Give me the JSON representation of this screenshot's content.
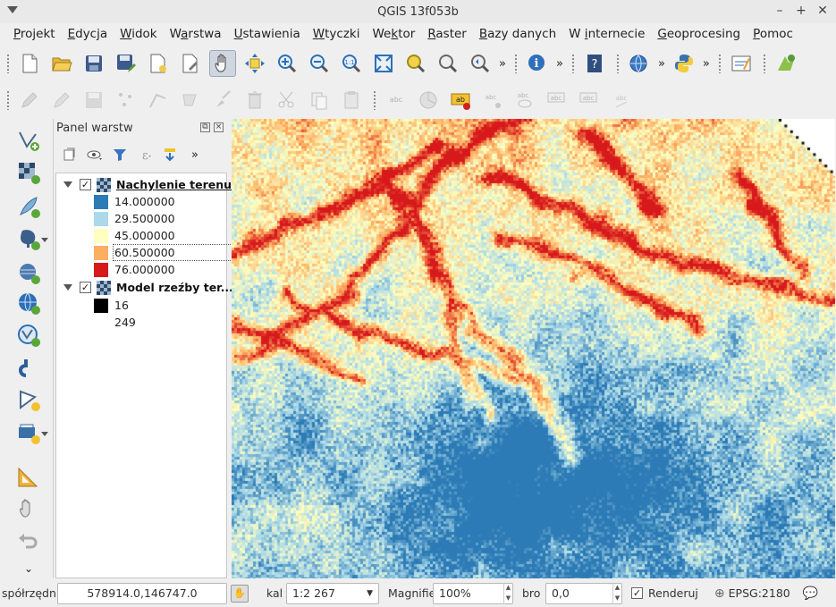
{
  "window": {
    "title": "QGIS 13f053b",
    "btn_min": "–",
    "btn_max": "+",
    "btn_close": "✕"
  },
  "menu": [
    {
      "label": "Projekt",
      "u": "P",
      "rest": "rojekt"
    },
    {
      "label": "Edycja",
      "u": "E",
      "rest": "dycja"
    },
    {
      "label": "Widok",
      "u": "W",
      "rest": "idok"
    },
    {
      "label": "Warstwa",
      "pre": "W",
      "u": "a",
      "rest": "rstwa"
    },
    {
      "label": "Ustawienia",
      "u": "U",
      "rest": "stawienia"
    },
    {
      "label": "Wtyczki",
      "u": "W",
      "rest": "tyczki"
    },
    {
      "label": "Wektor",
      "pre": "We",
      "u": "k",
      "rest": "tor"
    },
    {
      "label": "Raster",
      "u": "R",
      "rest": "aster"
    },
    {
      "label": "Bazy danych",
      "u": "B",
      "rest": "azy danych"
    },
    {
      "label": "W internecie",
      "pre": "W ",
      "u": "i",
      "rest": "nternecie"
    },
    {
      "label": "Geoprocesing",
      "u": "G",
      "rest": "eoprocesing"
    },
    {
      "label": "Pomoc",
      "u": "P",
      "rest": "omoc"
    }
  ],
  "toolbar1": {
    "buttons": [
      "new-project-icon",
      "open-project-icon",
      "save-project-icon",
      "save-as-icon",
      "new-print-composer-icon",
      "composer-manager-icon",
      "pan-icon",
      "pan-to-selection-icon",
      "zoom-in-icon",
      "zoom-out-icon",
      "zoom-native-icon",
      "zoom-full-icon",
      "zoom-to-selection-icon",
      "zoom-to-layer-icon",
      "zoom-last-icon"
    ],
    "overflow": "»"
  },
  "layers_panel": {
    "title": "Panel warstw",
    "layers": [
      {
        "name": "Nachylenie terenu",
        "checked": true,
        "legend": [
          {
            "label": "14.000000",
            "color": "#2c7bb6"
          },
          {
            "label": "29.500000",
            "color": "#abd9e9"
          },
          {
            "label": "45.000000",
            "color": "#ffffbf"
          },
          {
            "label": "60.500000",
            "color": "#fdae61"
          },
          {
            "label": "76.000000",
            "color": "#d7191c"
          }
        ]
      },
      {
        "name": "Model rzeźby ter...",
        "checked": true,
        "legend": [
          {
            "label": "16",
            "color": "#000000"
          },
          {
            "label": "249",
            "color": "#ffffff"
          }
        ]
      }
    ]
  },
  "statusbar": {
    "coord_label": "spółrzędn",
    "coord_value": "578914.0,146747.0",
    "scale_label": "kal",
    "scale_value": "1:2 267",
    "magnifier_label": "Magnifie",
    "magnifier_value": "100%",
    "rotation_label": "bro",
    "rotation_value": "0,0",
    "render_label": "Renderuj",
    "render_checked": true,
    "crs": "EPSG:2180"
  }
}
